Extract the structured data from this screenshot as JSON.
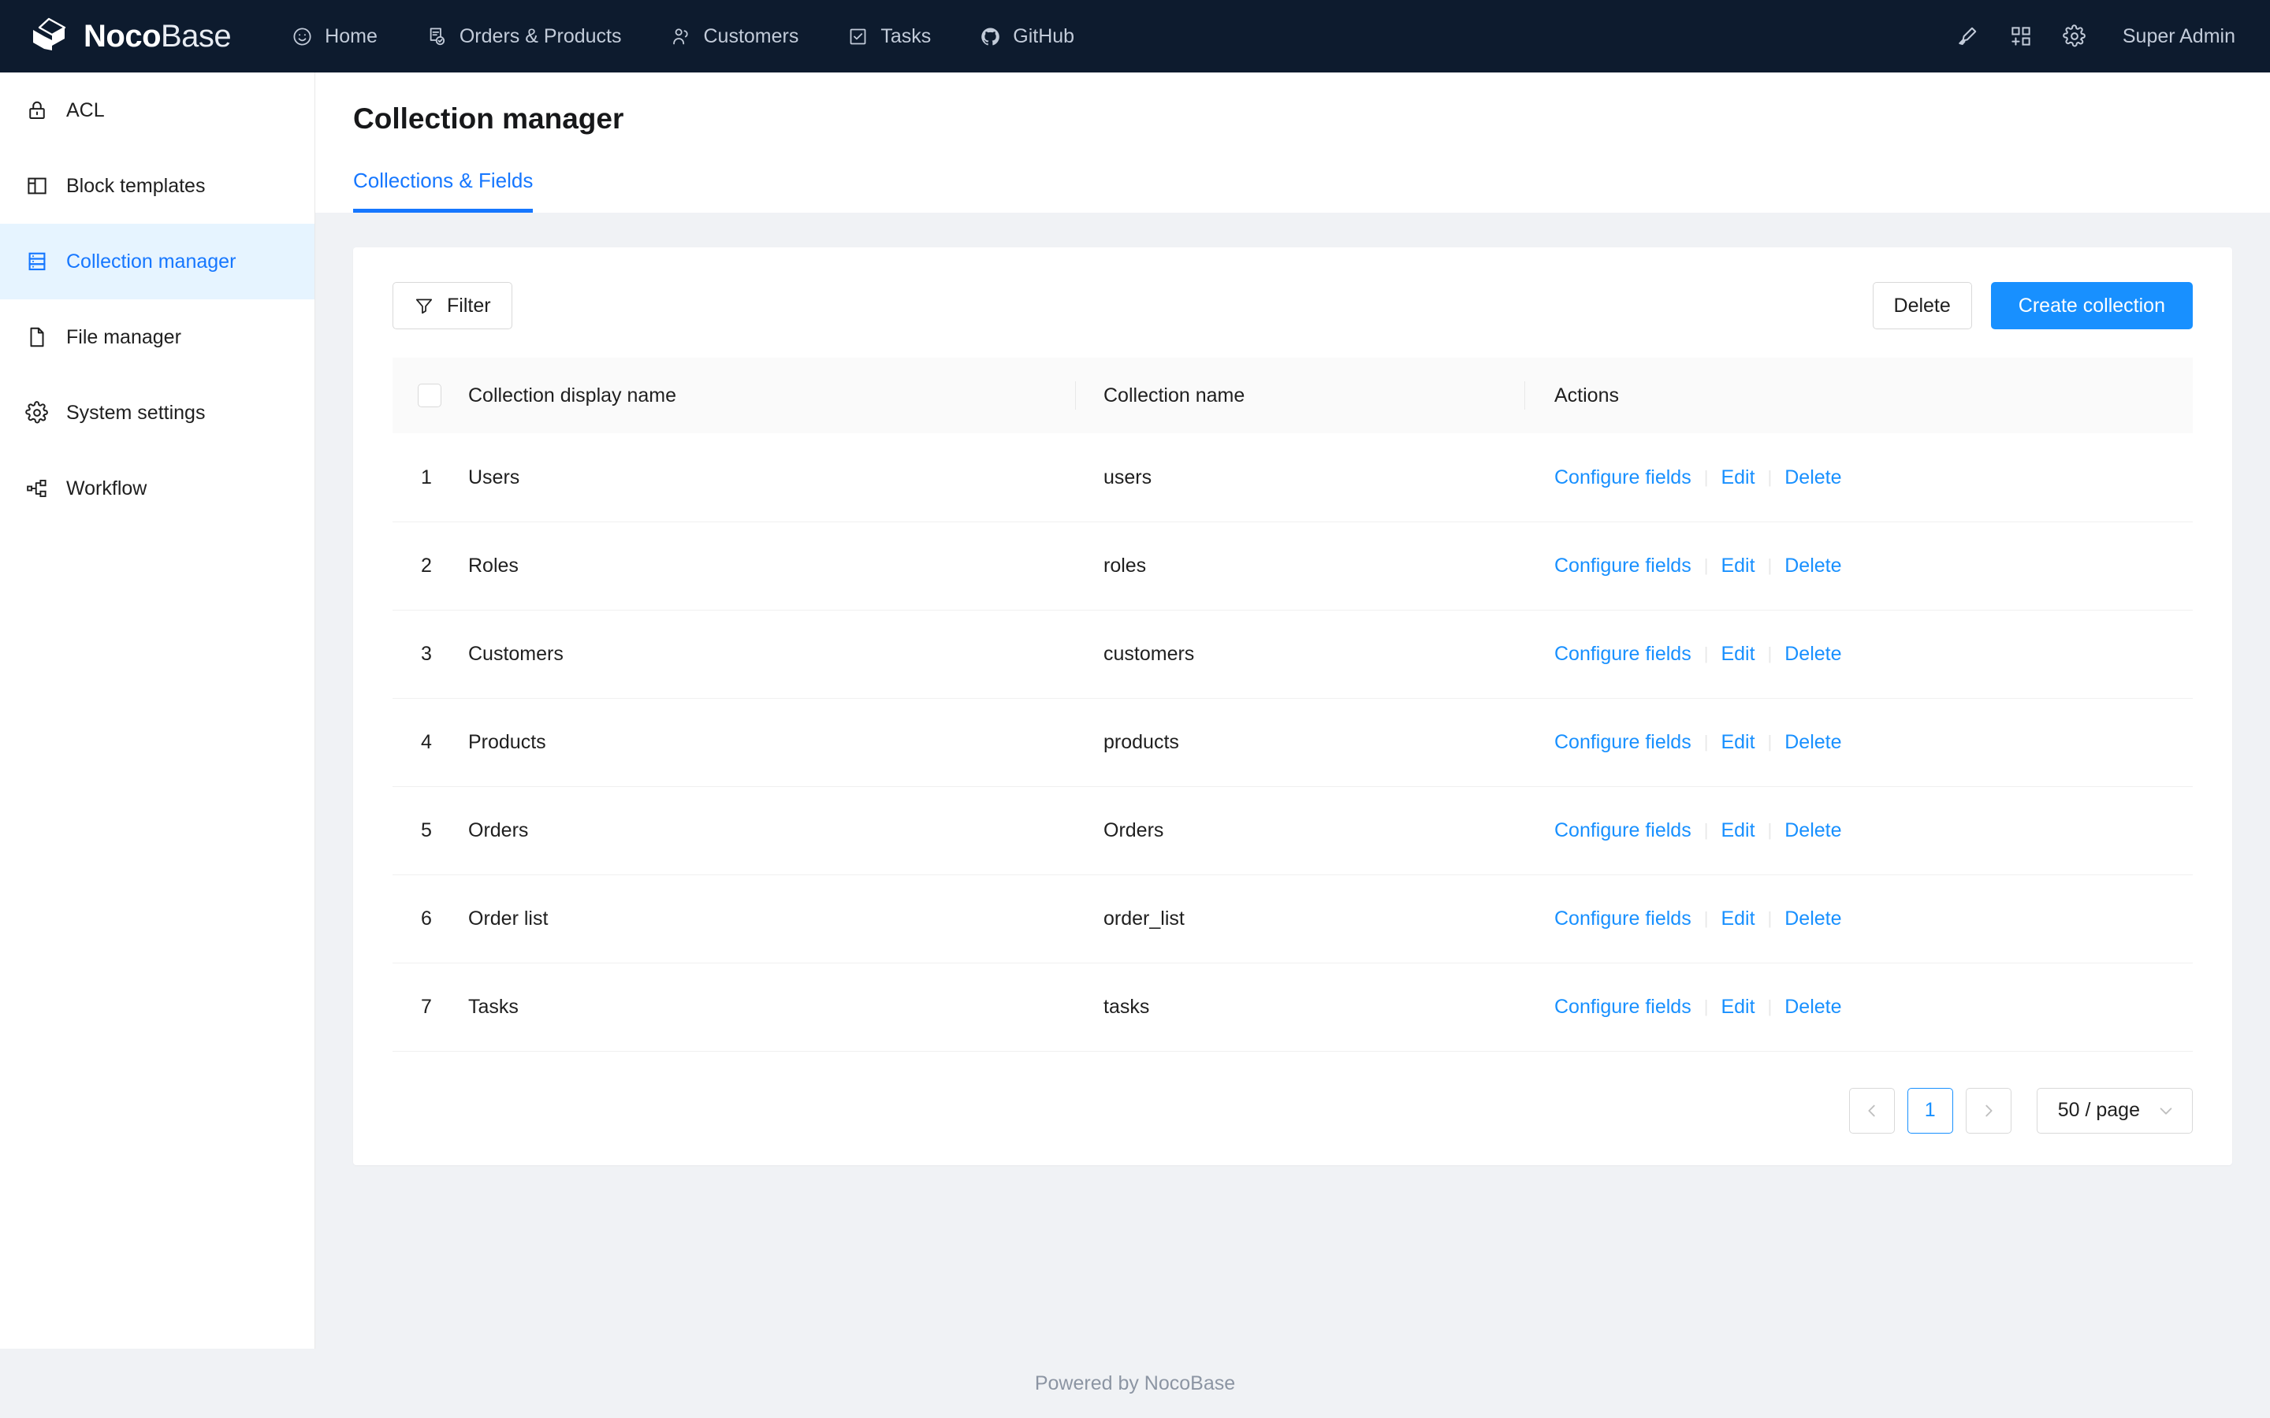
{
  "brand": {
    "name_bold": "Noco",
    "name_light": "Base",
    "logo_icon": "nocobase-cube-logo"
  },
  "topnav": {
    "items": [
      {
        "label": "Home",
        "icon": "smiley-face-icon"
      },
      {
        "label": "Orders & Products",
        "icon": "document-check-icon"
      },
      {
        "label": "Customers",
        "icon": "user-group-icon"
      },
      {
        "label": "Tasks",
        "icon": "checkbox-checked-icon"
      },
      {
        "label": "GitHub",
        "icon": "github-icon"
      }
    ],
    "right_icons": [
      {
        "name": "highlighter-pen-icon"
      },
      {
        "name": "add-block-icon"
      },
      {
        "name": "gear-icon"
      }
    ],
    "user": "Super Admin"
  },
  "sidebar": {
    "items": [
      {
        "label": "ACL",
        "icon": "lock-icon",
        "active": false
      },
      {
        "label": "Block templates",
        "icon": "layout-panel-icon",
        "active": false
      },
      {
        "label": "Collection manager",
        "icon": "database-stack-icon",
        "active": true
      },
      {
        "label": "File manager",
        "icon": "file-icon",
        "active": false
      },
      {
        "label": "System settings",
        "icon": "gear-icon",
        "active": false
      },
      {
        "label": "Workflow",
        "icon": "workflow-nodes-icon",
        "active": false
      }
    ]
  },
  "page": {
    "title": "Collection manager",
    "tabs": [
      {
        "label": "Collections & Fields",
        "active": true
      }
    ]
  },
  "toolbar": {
    "filter_label": "Filter",
    "filter_icon": "funnel-filter-icon",
    "delete_label": "Delete",
    "create_label": "Create collection",
    "primary_color": "#1890ff"
  },
  "table": {
    "columns": [
      "",
      "Collection display name",
      "Collection name",
      "Actions"
    ],
    "select_all_checked": false,
    "action_labels": {
      "configure": "Configure fields",
      "edit": "Edit",
      "delete": "Delete"
    },
    "rows": [
      {
        "num": "1",
        "display_name": "Users",
        "name": "users"
      },
      {
        "num": "2",
        "display_name": "Roles",
        "name": "roles"
      },
      {
        "num": "3",
        "display_name": "Customers",
        "name": "customers"
      },
      {
        "num": "4",
        "display_name": "Products",
        "name": "products"
      },
      {
        "num": "5",
        "display_name": "Orders",
        "name": "Orders"
      },
      {
        "num": "6",
        "display_name": "Order list",
        "name": "order_list"
      },
      {
        "num": "7",
        "display_name": "Tasks",
        "name": "tasks"
      }
    ]
  },
  "pagination": {
    "prev_icon": "chevron-left-icon",
    "next_icon": "chevron-right-icon",
    "current_page": "1",
    "page_size_label": "50 / page",
    "page_size_icon": "chevron-down-icon"
  },
  "footer": {
    "text": "Powered by NocoBase"
  }
}
